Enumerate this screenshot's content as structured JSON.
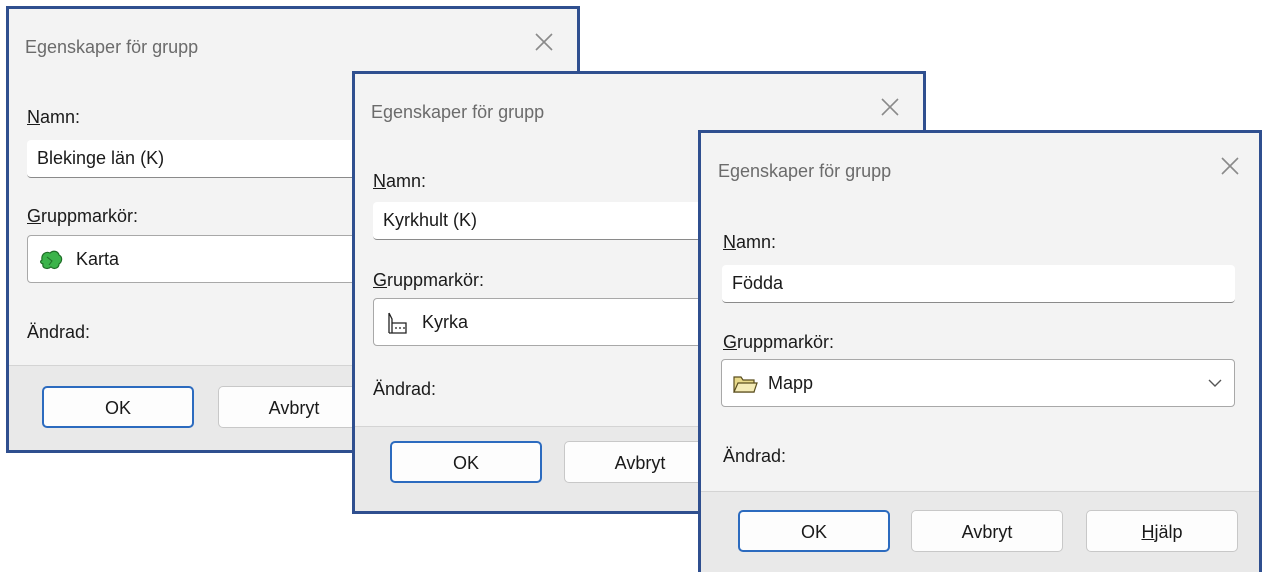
{
  "dialogs": [
    {
      "title": "Egenskaper för grupp",
      "name_label": "Namn:",
      "name_value": "Blekinge län (K)",
      "marker_label": "Gruppmarkör:",
      "marker_value": "Karta",
      "marker_icon": "map-icon",
      "changed_label": "Ändrad:",
      "buttons": {
        "ok": "OK",
        "cancel": "Avbryt"
      }
    },
    {
      "title": "Egenskaper för grupp",
      "name_label": "Namn:",
      "name_value": "Kyrkhult (K)",
      "marker_label": "Gruppmarkör:",
      "marker_value": "Kyrka",
      "marker_icon": "church-icon",
      "changed_label": "Ändrad:",
      "buttons": {
        "ok": "OK",
        "cancel": "Avbryt"
      }
    },
    {
      "title": "Egenskaper för grupp",
      "name_label": "Namn:",
      "name_value": "Födda",
      "marker_label": "Gruppmarkör:",
      "marker_value": "Mapp",
      "marker_icon": "folder-icon",
      "changed_label": "Ändrad:",
      "buttons": {
        "ok": "OK",
        "cancel": "Avbryt",
        "help": "Hjälp"
      }
    }
  ],
  "colors": {
    "frame": "#2f4f8f",
    "primary_button_border": "#2c6bbf",
    "map_icon": "#3bb34a",
    "folder_icon": "#e8d98a"
  }
}
